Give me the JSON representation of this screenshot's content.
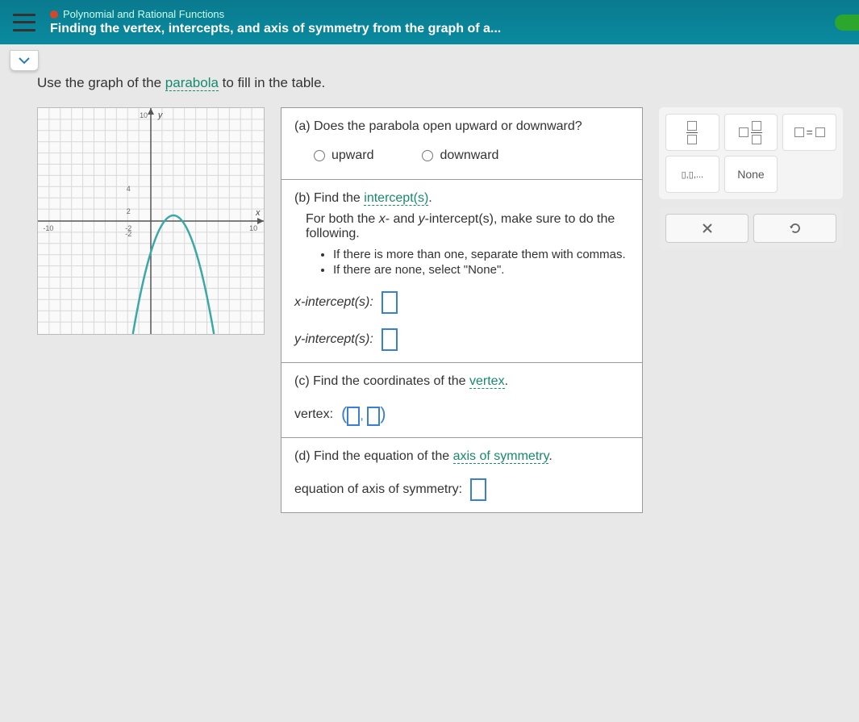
{
  "header": {
    "breadcrumb": "Polynomial and Rational Functions",
    "title": "Finding the vertex, intercepts, and axis of symmetry from the graph of a..."
  },
  "instruction": {
    "prefix": "Use the graph of the ",
    "term": "parabola",
    "suffix": " to fill in the table."
  },
  "chart_data": {
    "type": "line",
    "title": "",
    "xlabel": "x",
    "ylabel": "y",
    "xlim": [
      -10,
      10
    ],
    "ylim": [
      -10,
      10
    ],
    "grid": true,
    "series": [
      {
        "name": "parabola",
        "function": "y = -(x - 2)^2 + 1",
        "vertex": [
          2,
          1
        ],
        "x_intercepts": [
          1,
          3
        ],
        "y_intercept": -3
      }
    ]
  },
  "questions": {
    "a": {
      "prompt": "(a) Does the parabola open upward or downward?",
      "opt1": "upward",
      "opt2": "downward"
    },
    "b": {
      "prompt_prefix": "(b) Find the ",
      "prompt_term": "intercept(s)",
      "prompt_suffix": ".",
      "desc_prefix": "For both the ",
      "desc_x": "x",
      "desc_mid": "- and ",
      "desc_y": "y",
      "desc_suffix": "-intercept(s), make sure to do the following.",
      "bullet1": "If there is more than one, separate them with commas.",
      "bullet2": "If there are none, select \"None\".",
      "x_label": "x-intercept(s):",
      "y_label": "y-intercept(s):"
    },
    "c": {
      "prompt_prefix": "(c) Find the coordinates of the ",
      "prompt_term": "vertex",
      "prompt_suffix": ".",
      "label": "vertex:"
    },
    "d": {
      "prompt_prefix": "(d) Find the equation of the ",
      "prompt_term": "axis of symmetry",
      "prompt_suffix": ".",
      "label": "equation of axis of symmetry:"
    }
  },
  "toolbox": {
    "none_label": "None",
    "list_label": "▯,▯,..."
  }
}
